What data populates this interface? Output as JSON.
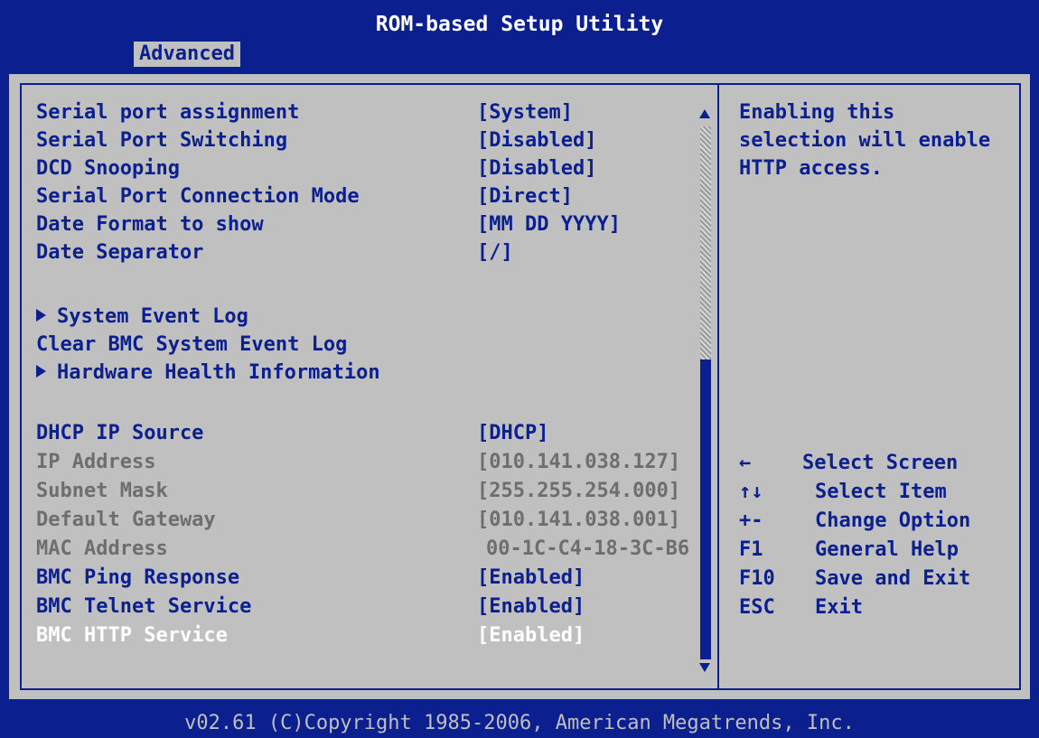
{
  "title": "ROM-based Setup Utility",
  "tab": "Advanced",
  "settings": [
    {
      "label": "Serial port assignment",
      "value": "[System]"
    },
    {
      "label": "Serial Port Switching",
      "value": "[Disabled]"
    },
    {
      "label": "DCD Snooping",
      "value": "[Disabled]"
    },
    {
      "label": "Serial Port Connection Mode",
      "value": "[Direct]"
    },
    {
      "label": "Date Format to show",
      "value": "[MM DD YYYY]"
    },
    {
      "label": "Date Separator",
      "value": "[/]"
    },
    {
      "label": "System Event Log"
    },
    {
      "label": "Clear BMC System Event Log"
    },
    {
      "label": "Hardware Health Information"
    },
    {
      "label": "DHCP IP Source",
      "value": "[DHCP]"
    },
    {
      "label": "IP Address",
      "value": "[010.141.038.127]"
    },
    {
      "label": "Subnet Mask",
      "value": "[255.255.254.000]"
    },
    {
      "label": "Default Gateway",
      "value": "[010.141.038.001]"
    },
    {
      "label": "MAC Address",
      "value": "00-1C-C4-18-3C-B6"
    },
    {
      "label": "BMC Ping Response",
      "value": "[Enabled]"
    },
    {
      "label": "BMC Telnet Service",
      "value": "[Enabled]"
    },
    {
      "label": "BMC HTTP Service",
      "value": "[Enabled]"
    }
  ],
  "help_text": [
    "Enabling this",
    "selection will enable",
    "HTTP access."
  ],
  "keys": [
    {
      "key": "←",
      "desc": "Select Screen"
    },
    {
      "key": "↑↓",
      "desc": "Select Item"
    },
    {
      "key": "+-",
      "desc": "Change Option"
    },
    {
      "key": "F1",
      "desc": "General Help"
    },
    {
      "key": "F10",
      "desc": "Save and Exit"
    },
    {
      "key": "ESC",
      "desc": "Exit"
    }
  ],
  "footer": "v02.61 (C)Copyright 1985-2006, American Megatrends, Inc.",
  "colors": {
    "background": "#0b1f8f",
    "panel": "#c0c0c0",
    "text": "#0b1f8f",
    "disabled": "#6e6e6e",
    "selected": "#ffffff"
  }
}
